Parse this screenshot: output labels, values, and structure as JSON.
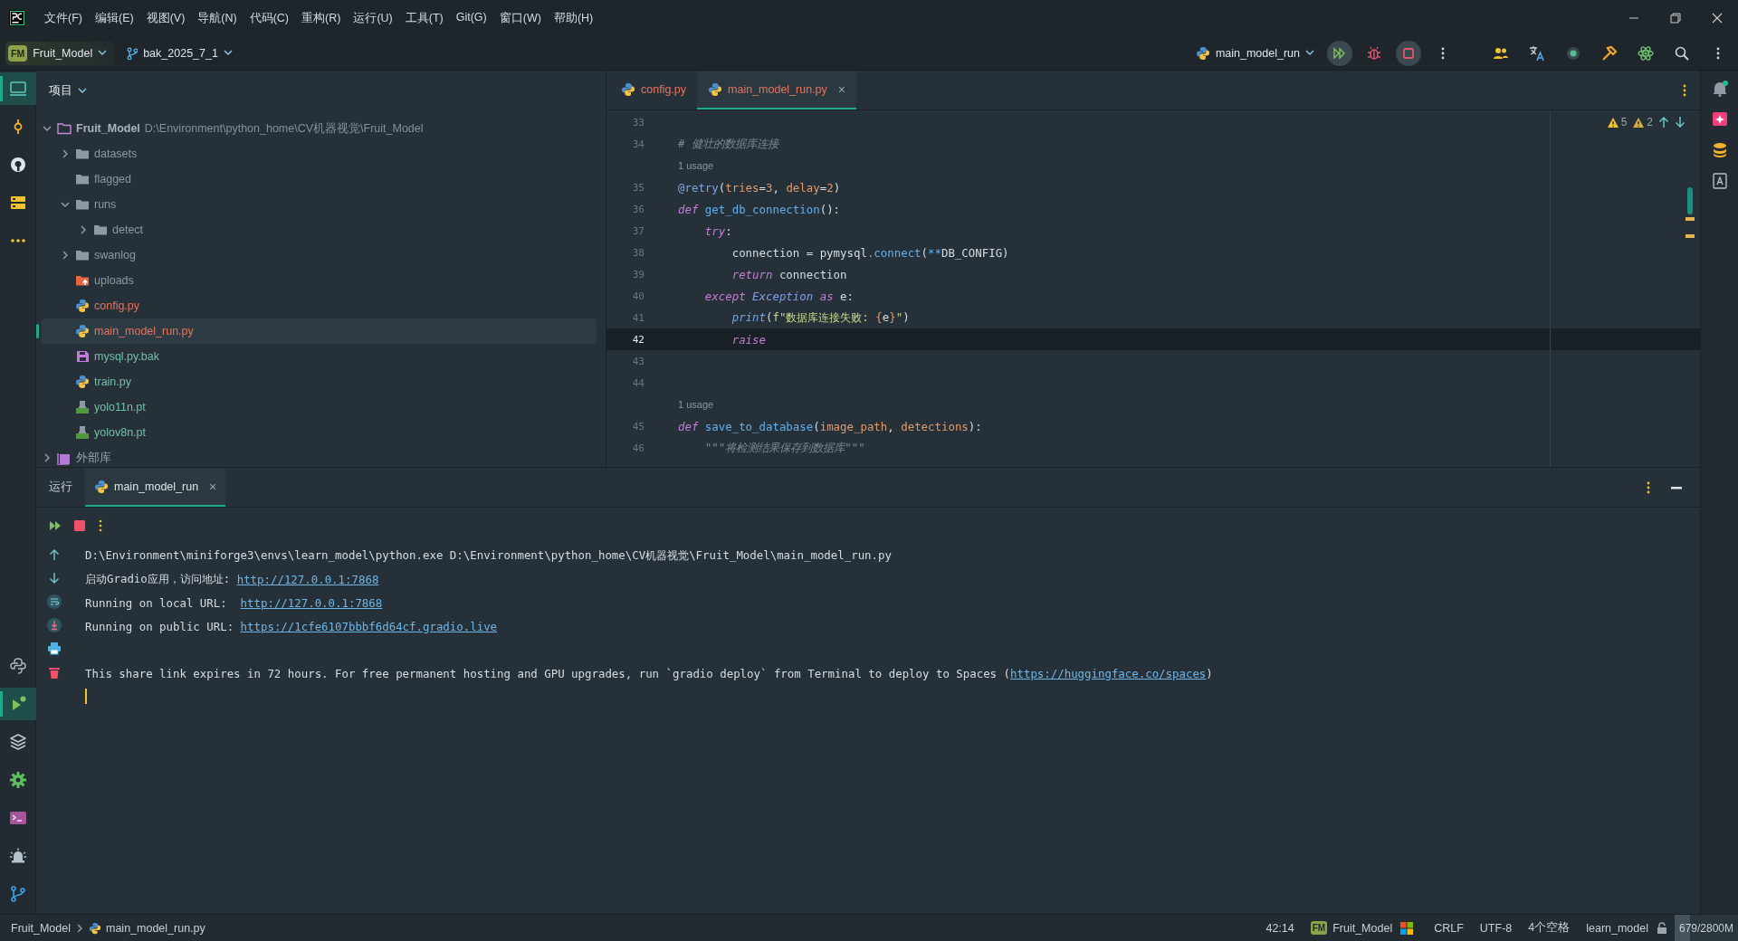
{
  "title_bar": {
    "menu": [
      "文件(F)",
      "编辑(E)",
      "视图(V)",
      "导航(N)",
      "代码(C)",
      "重构(R)",
      "运行(U)",
      "工具(T)",
      "Git(G)",
      "窗口(W)",
      "帮助(H)"
    ]
  },
  "toolbar": {
    "project_badge": "FM",
    "project": "Fruit_Model",
    "branch": "bak_2025_7_1",
    "run_config": "main_model_run"
  },
  "left_strip": {
    "top": [
      {
        "kind": "project",
        "selected": true
      },
      {
        "kind": "commit",
        "selected": false
      },
      {
        "kind": "github",
        "selected": false
      },
      {
        "kind": "structure",
        "selected": false
      },
      {
        "kind": "more",
        "selected": false
      }
    ],
    "bottom": [
      {
        "kind": "python-console",
        "selected": false
      },
      {
        "kind": "run",
        "selected": true
      },
      {
        "kind": "layers",
        "selected": false
      },
      {
        "kind": "settings",
        "selected": false
      },
      {
        "kind": "terminal",
        "selected": false
      },
      {
        "kind": "problems",
        "selected": false
      },
      {
        "kind": "git",
        "selected": false
      }
    ]
  },
  "project_panel": {
    "title": "项目",
    "tree": [
      {
        "name": "Fruit_Model",
        "path": "D:\\Environment\\python_home\\CV机器视觉\\Fruit_Model",
        "kind": "root",
        "expanded": true,
        "selected": false,
        "children": [
          {
            "name": "datasets",
            "kind": "folder",
            "expanded": false,
            "selected": false,
            "color": "#8d9aa5"
          },
          {
            "name": "flagged",
            "kind": "folder",
            "selected": false,
            "color": "#8d9aa5"
          },
          {
            "name": "runs",
            "kind": "folder",
            "expanded": true,
            "selected": false,
            "color": "#8d9aa5",
            "children": [
              {
                "name": "detect",
                "kind": "folder",
                "expanded": false,
                "selected": false,
                "color": "#8d9aa5"
              }
            ]
          },
          {
            "name": "swanlog",
            "kind": "folder",
            "expanded": false,
            "selected": false,
            "color": "#8d9aa5"
          },
          {
            "name": "uploads",
            "kind": "upload-folder",
            "selected": false,
            "color": "#8d9aa5"
          },
          {
            "name": "config.py",
            "kind": "python",
            "selected": false,
            "color": "#e8735c"
          },
          {
            "name": "main_model_run.py",
            "kind": "python",
            "selected": true,
            "color": "#e8735c"
          },
          {
            "name": "mysql.py.bak",
            "kind": "backup",
            "selected": false,
            "color": "#6fc1a6"
          },
          {
            "name": "train.py",
            "kind": "python",
            "selected": false,
            "color": "#6fc1a6"
          },
          {
            "name": "yolo11n.pt",
            "kind": "model",
            "selected": false,
            "color": "#6fc1a6"
          },
          {
            "name": "yolov8n.pt",
            "kind": "model",
            "selected": false,
            "color": "#6fc1a6"
          }
        ]
      },
      {
        "name": "外部库",
        "kind": "library",
        "expanded": false,
        "selected": false
      }
    ]
  },
  "editor": {
    "tabs": [
      {
        "label": "config.py",
        "selected": false
      },
      {
        "label": "main_model_run.py",
        "selected": true,
        "close": "×"
      }
    ],
    "inspections": [
      {
        "kind": "warning",
        "count": "5"
      },
      {
        "kind": "weak-warning",
        "count": "2"
      }
    ],
    "lines": [
      {
        "kind": "code",
        "number": "33",
        "current": false
      },
      {
        "kind": "code",
        "number": "34",
        "current": false,
        "tokens": [
          {
            "t": "# 健壮的数据库连接",
            "kind": "comment"
          }
        ]
      },
      {
        "kind": "usage",
        "text": "1 usage"
      },
      {
        "kind": "code",
        "number": "35",
        "current": false,
        "tokens": [
          {
            "t": "@retry",
            "kind": "deco"
          },
          {
            "t": "(",
            "kind": "plain"
          },
          {
            "t": "tries",
            "kind": "param"
          },
          {
            "t": "=",
            "kind": "plain"
          },
          {
            "t": "3",
            "kind": "num"
          },
          {
            "t": ", ",
            "kind": "plain"
          },
          {
            "t": "delay",
            "kind": "param"
          },
          {
            "t": "=",
            "kind": "plain"
          },
          {
            "t": "2",
            "kind": "num"
          },
          {
            "t": ")",
            "kind": "plain"
          }
        ]
      },
      {
        "kind": "code",
        "number": "36",
        "current": false,
        "tokens": [
          {
            "t": "def",
            "kind": "kw"
          },
          {
            "t": " get_db_connection",
            "kind": "fn"
          },
          {
            "t": "():",
            "kind": "plain"
          }
        ]
      },
      {
        "kind": "code",
        "number": "37",
        "current": false,
        "tokens": [
          {
            "t": "    try",
            "kind": "kw"
          },
          {
            "t": ":",
            "kind": "plain"
          }
        ]
      },
      {
        "kind": "code",
        "number": "38",
        "current": false,
        "tokens": [
          {
            "t": "        connection = pymysql",
            "kind": "plain"
          },
          {
            "t": ".connect",
            "kind": "fn"
          },
          {
            "t": "(",
            "kind": "plain"
          },
          {
            "t": "**",
            "kind": "op"
          },
          {
            "t": "DB_CONFIG)",
            "kind": "plain"
          }
        ]
      },
      {
        "kind": "code",
        "number": "39",
        "current": false,
        "tokens": [
          {
            "t": "        return",
            "kind": "kw"
          },
          {
            "t": " connection",
            "kind": "plain"
          }
        ]
      },
      {
        "kind": "code",
        "number": "40",
        "current": false,
        "tokens": [
          {
            "t": "    except",
            "kind": "kw"
          },
          {
            "t": " Exception",
            "kind": "cls"
          },
          {
            "t": " as",
            "kind": "kw"
          },
          {
            "t": " e:",
            "kind": "plain"
          }
        ]
      },
      {
        "kind": "code",
        "number": "41",
        "current": false,
        "tokens": [
          {
            "t": "        print",
            "kind": "builtin"
          },
          {
            "t": "(",
            "kind": "plain"
          },
          {
            "t": "f\"数据库连接失败: ",
            "kind": "str"
          },
          {
            "t": "{",
            "kind": "num"
          },
          {
            "t": "e",
            "kind": "plain"
          },
          {
            "t": "}",
            "kind": "num"
          },
          {
            "t": "\"",
            "kind": "str"
          },
          {
            "t": ")",
            "kind": "plain"
          }
        ]
      },
      {
        "kind": "code",
        "number": "42",
        "current": true,
        "tokens": [
          {
            "t": "        raise",
            "kind": "kw"
          }
        ]
      },
      {
        "kind": "code",
        "number": "43",
        "current": false
      },
      {
        "kind": "code",
        "number": "44",
        "current": false
      },
      {
        "kind": "usage",
        "text": "1 usage"
      },
      {
        "kind": "code",
        "number": "45",
        "current": false,
        "tokens": [
          {
            "t": "def",
            "kind": "kw"
          },
          {
            "t": " save_to_database",
            "kind": "fn"
          },
          {
            "t": "(",
            "kind": "plain"
          },
          {
            "t": "image_path",
            "kind": "param"
          },
          {
            "t": ", ",
            "kind": "plain"
          },
          {
            "t": "detections",
            "kind": "param"
          },
          {
            "t": "):",
            "kind": "plain"
          }
        ]
      },
      {
        "kind": "code",
        "number": "46",
        "current": false,
        "tokens": [
          {
            "t": "    \"\"\"将检测结果保存到数据库\"\"\"",
            "kind": "doc"
          }
        ]
      }
    ]
  },
  "run_panel": {
    "title": "运行",
    "tabs": [
      {
        "label": "main_model_run",
        "selected": true,
        "close": "×"
      }
    ],
    "output": [
      {
        "kind": "text",
        "segments": [
          {
            "t": "D:\\Environment\\miniforge3\\envs\\learn_model\\python.exe D:\\Environment\\python_home\\CV机器视觉\\Fruit_Model\\main_model_run.py",
            "kind": "text"
          }
        ]
      },
      {
        "kind": "text",
        "segments": [
          {
            "t": "启动Gradio应用，访问地址: ",
            "kind": "text"
          },
          {
            "t": "http://127.0.0.1:7868",
            "kind": "link"
          }
        ]
      },
      {
        "kind": "text",
        "segments": [
          {
            "t": "Running on local URL:  ",
            "kind": "text"
          },
          {
            "t": "http://127.0.0.1:7868",
            "kind": "link"
          }
        ]
      },
      {
        "kind": "text",
        "segments": [
          {
            "t": "Running on public URL: ",
            "kind": "text"
          },
          {
            "t": "https://1cfe6107bbbf6d64cf.gradio.live",
            "kind": "link"
          }
        ]
      },
      {
        "kind": "blank"
      },
      {
        "kind": "text",
        "segments": [
          {
            "t": "This share link expires in 72 hours. For free permanent hosting and GPU upgrades, run `gradio deploy` from Terminal to deploy to Spaces (",
            "kind": "text"
          },
          {
            "t": "https://huggingface.co/spaces",
            "kind": "link"
          },
          {
            "t": ")",
            "kind": "text"
          }
        ]
      }
    ]
  },
  "status_bar": {
    "breadcrumbs": [
      "Fruit_Model",
      "main_model_run.py"
    ],
    "position": "42:14",
    "interpreter_badge": "FM",
    "interpreter_project": "Fruit_Model",
    "line_separator": "CRLF",
    "encoding": "UTF-8",
    "indent": "4个空格",
    "environment": "learn_model",
    "memory": {
      "text": "679/2800M",
      "level": 0.24
    }
  }
}
